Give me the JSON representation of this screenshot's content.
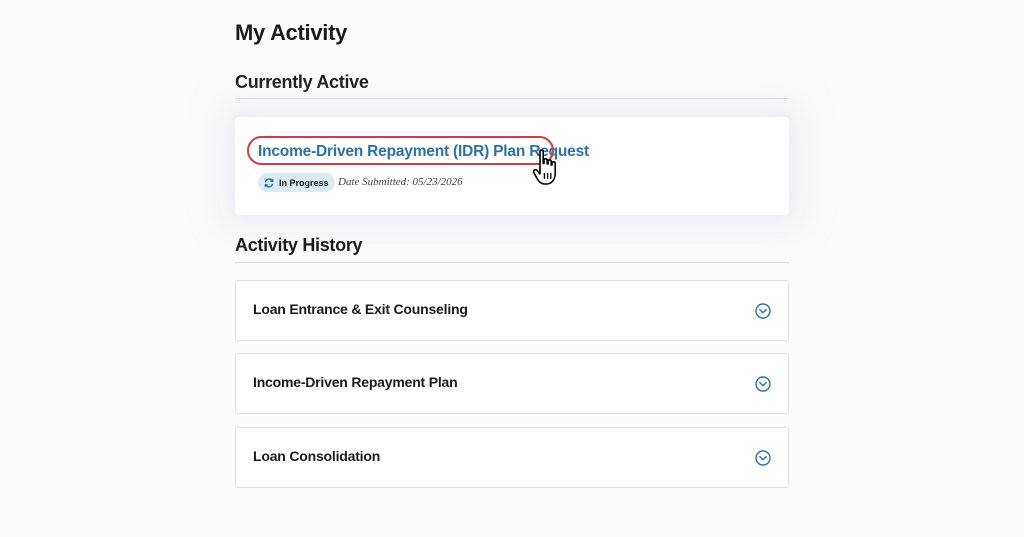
{
  "page": {
    "title": "My Activity"
  },
  "currently_active": {
    "heading": "Currently Active",
    "item": {
      "title": "Income-Driven Repayment (IDR) Plan Request",
      "status": "In Progress",
      "status_icon": "sync-icon",
      "date_submitted": "Date Submitted: 05/23/2026"
    }
  },
  "activity_history": {
    "heading": "Activity History",
    "items": [
      {
        "label": "Loan Entrance & Exit Counseling",
        "icon": "chevron-down-icon"
      },
      {
        "label": "Income-Driven Repayment Plan",
        "icon": "chevron-down-icon"
      },
      {
        "label": "Loan Consolidation",
        "icon": "chevron-down-icon"
      }
    ]
  },
  "colors": {
    "link": "#2a73a8",
    "highlight": "#d33b47",
    "badge_bg": "#d9ebf7",
    "chevron": "#2a73a8"
  }
}
